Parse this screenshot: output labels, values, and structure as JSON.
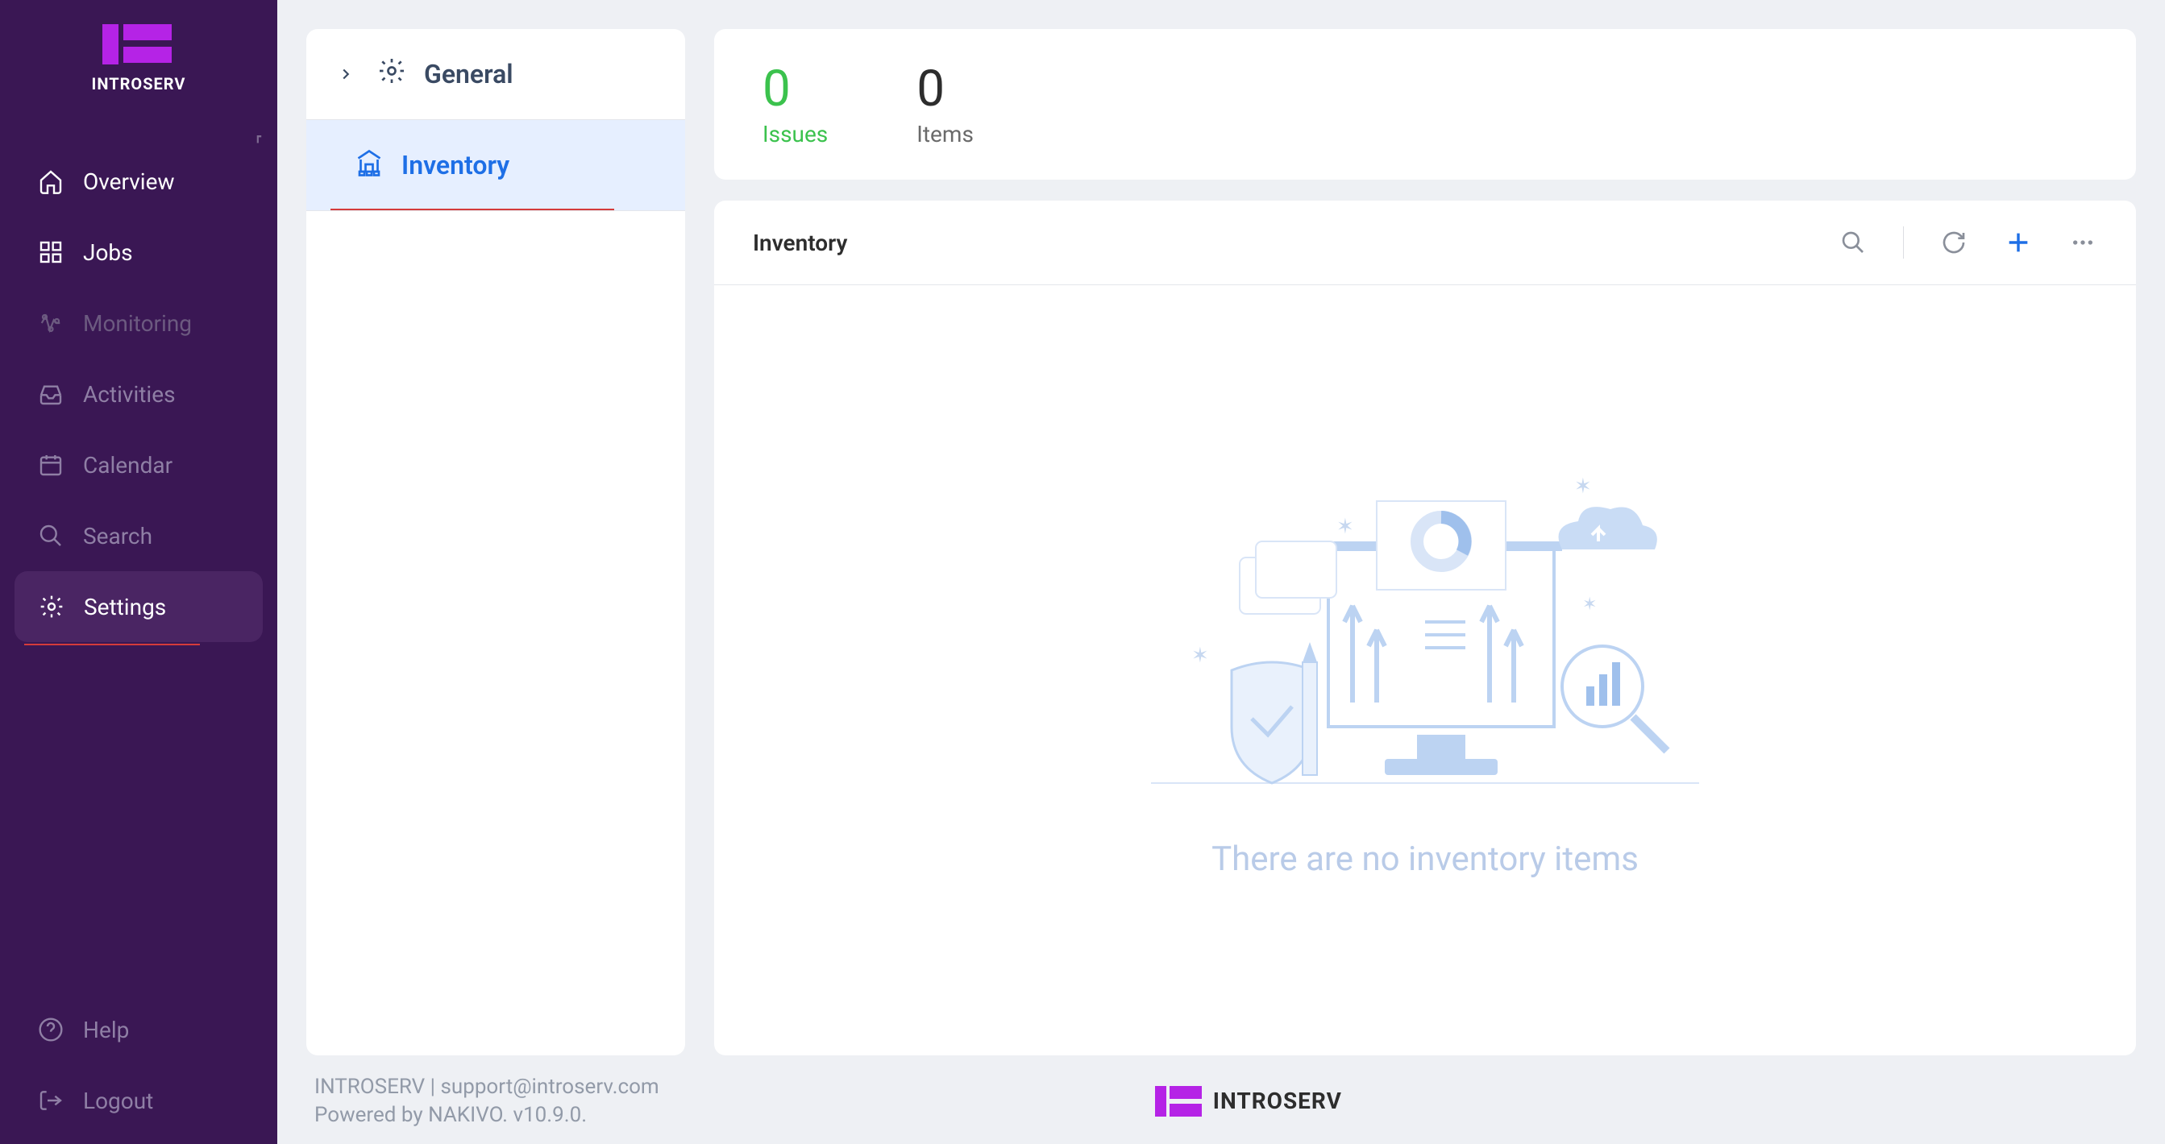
{
  "brand": {
    "name": "INTROSERV"
  },
  "sidebar": {
    "items": [
      {
        "label": "Overview",
        "icon": "home"
      },
      {
        "label": "Jobs",
        "icon": "grid"
      },
      {
        "label": "Monitoring",
        "icon": "activity"
      },
      {
        "label": "Activities",
        "icon": "inbox"
      },
      {
        "label": "Calendar",
        "icon": "calendar"
      },
      {
        "label": "Search",
        "icon": "search"
      },
      {
        "label": "Settings",
        "icon": "gear"
      },
      {
        "label": "Help",
        "icon": "help"
      },
      {
        "label": "Logout",
        "icon": "logout"
      }
    ]
  },
  "settings_panel": {
    "general_label": "General",
    "inventory_label": "Inventory"
  },
  "stats": {
    "issues_count": "0",
    "issues_label": "Issues",
    "items_count": "0",
    "items_label": "Items"
  },
  "inventory": {
    "title": "Inventory",
    "empty_text": "There are no inventory items"
  },
  "footer": {
    "line1": "INTROSERV | support@introserv.com",
    "line2": "Powered by NAKIVO. v10.9.0.",
    "brand": "INTROSERV"
  }
}
